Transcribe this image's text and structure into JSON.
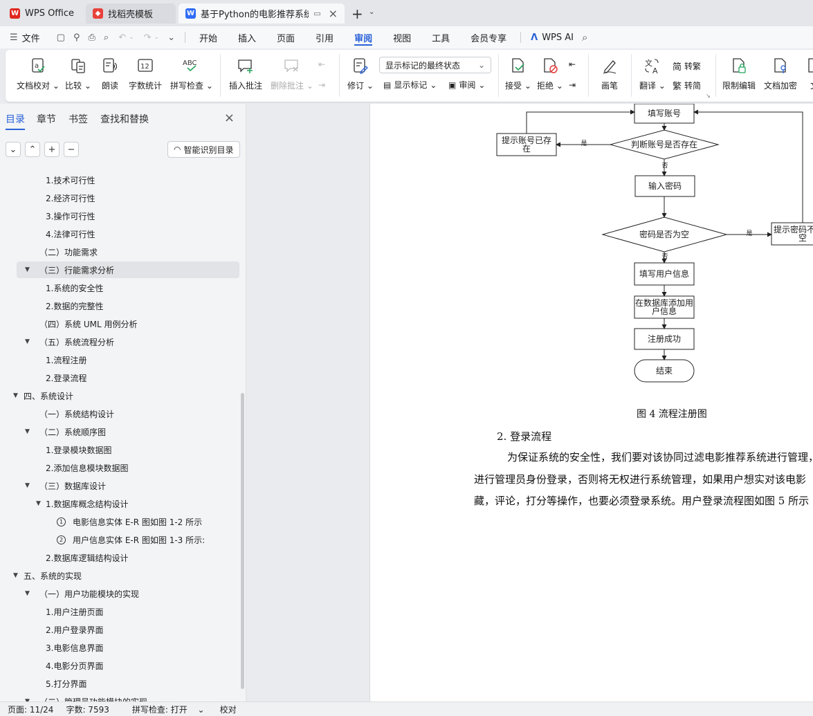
{
  "tabs": [
    {
      "label": "WPS Office",
      "icon": "wps-logo-icon",
      "color": "#e0271f"
    },
    {
      "label": "找稻壳模板",
      "icon": "docer-logo-icon",
      "color": "#e8413b"
    },
    {
      "label": "基于Python的电影推荐系统的",
      "icon": "wps-writer-icon",
      "color": "#2f6cf6"
    }
  ],
  "menu": {
    "file": "文件",
    "items": [
      "开始",
      "插入",
      "页面",
      "引用",
      "审阅",
      "视图",
      "工具",
      "会员专享"
    ],
    "active": "审阅",
    "wps_ai": "WPS AI"
  },
  "ribbon": {
    "doc_check": "文档校对",
    "compare": "比较",
    "read_aloud": "朗读",
    "word_count": "字数统计",
    "spell_check": "拼写检查",
    "insert_comment": "插入批注",
    "delete_comment": "删除批注",
    "track_changes": "修订",
    "markup_select": "显示标记的最终状态",
    "show_markup": "显示标记",
    "review": "审阅",
    "accept": "接受",
    "reject": "拒绝",
    "pen": "画笔",
    "translate": "翻译",
    "to_traditional": "转繁",
    "to_simplified": "转简",
    "restrict_edit": "限制编辑",
    "encrypt": "文档加密",
    "doc_cut": "文"
  },
  "sidebar": {
    "tabs": [
      "目录",
      "章节",
      "书签",
      "查找和替换"
    ],
    "smart_toc": "智能识别目录",
    "toc": [
      {
        "text": "1.技术可行性",
        "lv": 3
      },
      {
        "text": "2.经济可行性",
        "lv": 3
      },
      {
        "text": "3.操作可行性",
        "lv": 3
      },
      {
        "text": "4.法律可行性",
        "lv": 3
      },
      {
        "text": "（二）功能需求",
        "lv": 2
      },
      {
        "text": "（三）行能需求分析",
        "lv": 2,
        "tw": true,
        "sel": true
      },
      {
        "text": "1.系统的安全性",
        "lv": 3
      },
      {
        "text": "2.数据的完整性",
        "lv": 3
      },
      {
        "text": "（四）系统 UML 用例分析",
        "lv": 2
      },
      {
        "text": "（五）系统流程分析",
        "lv": 2,
        "tw": true
      },
      {
        "text": "1.流程注册",
        "lv": 3
      },
      {
        "text": "2.登录流程",
        "lv": 3
      },
      {
        "text": "四、系统设计",
        "lv": 1,
        "tw": true
      },
      {
        "text": "（一）系统结构设计",
        "lv": 2
      },
      {
        "text": "（二）系统顺序图",
        "lv": 2,
        "tw": true
      },
      {
        "text": "1.登录模块数据图",
        "lv": 3
      },
      {
        "text": "2.添加信息模块数据图",
        "lv": 3
      },
      {
        "text": "（三）数据库设计",
        "lv": 2,
        "tw": true
      },
      {
        "text": "1.数据库概念结构设计",
        "lv": 3,
        "tw": true
      },
      {
        "text": "电影信息实体 E-R 图如图 1-2 所示",
        "lv": 4,
        "num": "1"
      },
      {
        "text": "用户信息实体 E-R 图如图 1-3 所示:",
        "lv": 4,
        "num": "2"
      },
      {
        "text": "2.数据库逻辑结构设计",
        "lv": 3
      },
      {
        "text": "五、系统的实现",
        "lv": 1,
        "tw": true
      },
      {
        "text": "（一）用户功能模块的实现",
        "lv": 2,
        "tw": true
      },
      {
        "text": "1.用户注册页面",
        "lv": 3
      },
      {
        "text": "2.用户登录界面",
        "lv": 3
      },
      {
        "text": "3.电影信息界面",
        "lv": 3
      },
      {
        "text": "4.电影分页界面",
        "lv": 3
      },
      {
        "text": "5.打分界面",
        "lv": 3
      },
      {
        "text": "（二）管理员功能模块的实现",
        "lv": 2,
        "tw": true
      }
    ]
  },
  "flow": {
    "n1": "填写账号",
    "n2": "判断账号是否存在",
    "n3": "提示账号已存在",
    "n4": "输入密码",
    "n5": "密码是否为空",
    "n6": "提示密码不能为空",
    "n7": "填写用户信息",
    "n8": "在数据库添加用户信息",
    "n9": "注册成功",
    "n10": "结束",
    "yes": "是",
    "no": "否"
  },
  "doc": {
    "caption": "图 4 流程注册图",
    "heading": "2.  登录流程",
    "lines": [
      "为保证系统的安全性，我们要对该协同过滤电影推荐系统进行管理，",
      "进行管理员身份登录，否则将无权进行系统管理，如果用户想实对该电影",
      "藏，评论，打分等操作，也要必须登录系统。用户登录流程图如图 5 所示"
    ]
  },
  "status": {
    "page": "页面: 11/24",
    "words": "字数: 7593",
    "spell": "拼写检查: 打开",
    "proof": "校对"
  }
}
